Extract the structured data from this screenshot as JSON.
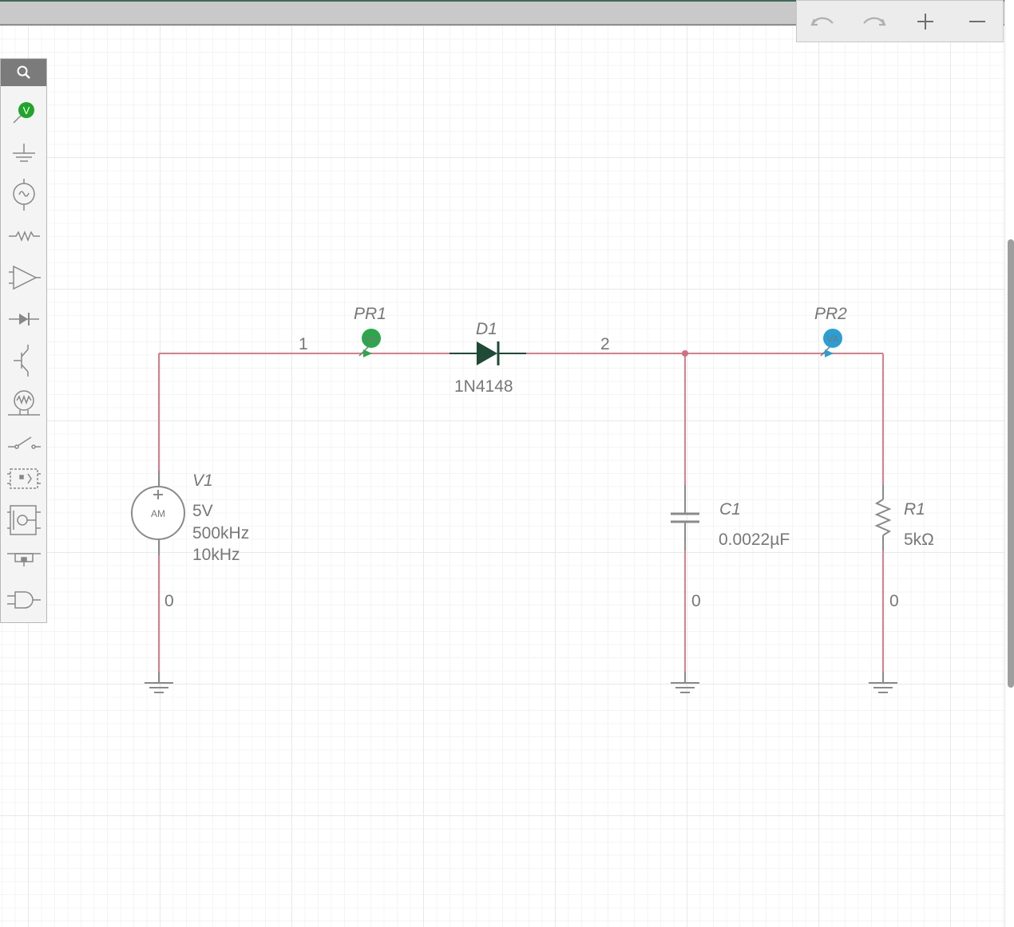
{
  "toolbar": {
    "undo_icon": "undo-icon",
    "redo_icon": "redo-icon",
    "zoom_in_icon": "plus-icon",
    "zoom_out_icon": "minus-icon"
  },
  "palette": {
    "items": [
      {
        "name": "search-icon"
      },
      {
        "name": "voltage-probe-icon"
      },
      {
        "name": "ground-icon"
      },
      {
        "name": "ac-source-icon"
      },
      {
        "name": "resistor-icon"
      },
      {
        "name": "opamp-icon"
      },
      {
        "name": "diode-icon"
      },
      {
        "name": "transistor-icon"
      },
      {
        "name": "lamp-icon"
      },
      {
        "name": "switch-icon"
      },
      {
        "name": "relay-icon"
      },
      {
        "name": "timer-ic-icon"
      },
      {
        "name": "connector-icon"
      },
      {
        "name": "logic-gate-icon"
      }
    ]
  },
  "schematic": {
    "wire_color": "#d4808e",
    "nodes": {
      "n1": "1",
      "n2": "2",
      "ground_v1": "0",
      "ground_c1": "0",
      "ground_r1": "0"
    },
    "v1": {
      "ref": "V1",
      "symbol": "AM",
      "amplitude": "5V",
      "carrier": "500kHz",
      "modulation": "10kHz"
    },
    "d1": {
      "ref": "D1",
      "model": "1N4148"
    },
    "c1": {
      "ref": "C1",
      "value": "0.0022µF"
    },
    "r1": {
      "ref": "R1",
      "value": "5kΩ"
    },
    "pr1": {
      "ref": "PR1",
      "badge": "VA",
      "color": "#2aa84a"
    },
    "pr2": {
      "ref": "PR2",
      "badge": "VA",
      "color": "#2a9fd6"
    }
  }
}
